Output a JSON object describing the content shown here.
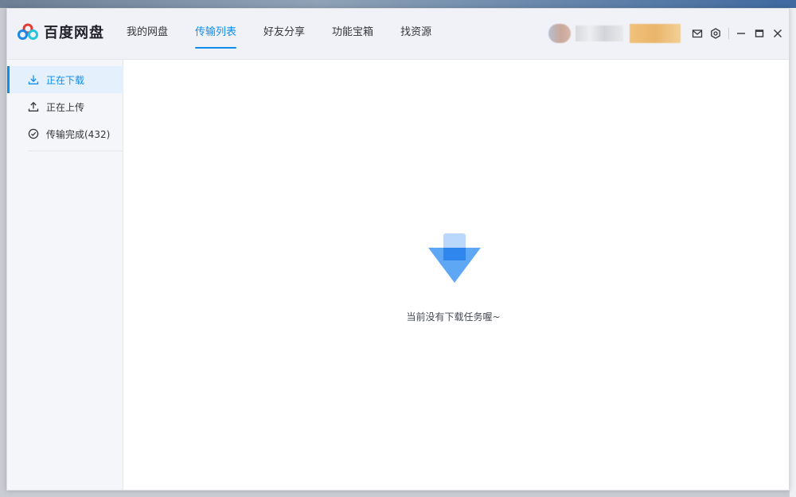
{
  "app": {
    "name": "百度网盘",
    "brand_color": "#0f8dec"
  },
  "nav": {
    "tabs": [
      {
        "label": "我的网盘",
        "active": false
      },
      {
        "label": "传输列表",
        "active": true
      },
      {
        "label": "好友分享",
        "active": false
      },
      {
        "label": "功能宝箱",
        "active": false
      },
      {
        "label": "找资源",
        "active": false
      }
    ]
  },
  "header_icons": [
    "mail-icon",
    "settings-icon",
    "minimize-icon",
    "maximize-icon",
    "close-icon"
  ],
  "sidebar": {
    "items": [
      {
        "label": "正在下载",
        "icon": "download-icon",
        "active": true
      },
      {
        "label": "正在上传",
        "icon": "upload-icon",
        "active": false
      },
      {
        "label": "传输完成(432)",
        "icon": "check-circle-icon",
        "active": false
      }
    ]
  },
  "main": {
    "empty_message": "当前没有下载任务喔~"
  }
}
